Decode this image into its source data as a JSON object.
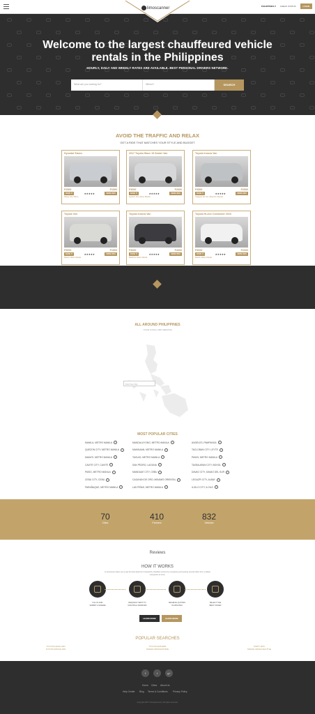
{
  "header": {
    "logo_text": "limoscanner",
    "country": "PHILIPPINES",
    "check_status": "CHECK STATUS",
    "login": "LOGIN"
  },
  "hero": {
    "title_line1": "Welcome to the largest chauffeured vehicle",
    "title_line2": "rentals in the Philippines",
    "subtitle": "HOURLY, DAILY AND WEEKLY RATES ARE AVAILABLE. BEST PERSONAL DRIVERS NETWORK.",
    "what_placeholder": "What are you looking for?",
    "where_placeholder": "Where?",
    "search_button": "SEARCH"
  },
  "vehicles": {
    "title": "AVOID THE TRAFFIC AND RELAX",
    "subtitle": "GET A RIDE THAT MATCHES YOUR STYLE AND BUDGET",
    "cards": [
      {
        "name": "Hyundai Starex",
        "p1": "P2500",
        "p2": "P1500",
        "tag": "BOOK IT",
        "more": "MORE INFO",
        "stars": "★★★★★",
        "loc": "Pasay City, Metro",
        "car_color": "#c9ccd0"
      },
      {
        "name": "2017 Toyota Hiace 15 Seater Van",
        "p1": "P3000",
        "p2": "P2000",
        "tag": "BOOK IT",
        "more": "MORE INFO",
        "stars": "★★★★★",
        "loc": "Quezon City, Metro Manila",
        "car_color": "#d6d7d8"
      },
      {
        "name": "Toyota Innova Van",
        "p1": "P3500",
        "p2": "P2500",
        "tag": "BOOK IT",
        "more": "MORE INFO",
        "stars": "★★★★★",
        "loc": "Cagayan de Oro, Misamis Oriental",
        "car_color": "#bfc2c5"
      },
      {
        "name": "Toyota Van",
        "p1": "P3000",
        "p2": "P1500",
        "tag": "BOOK IT",
        "more": "MORE INFO",
        "stars": "★★★★★",
        "loc": "Manila, Metro Manila",
        "car_color": "#d9d9d6"
      },
      {
        "name": "Toyota Innova Van",
        "p1": "P3000",
        "p2": "P4000",
        "tag": "BOOK IT",
        "more": "MORE INFO",
        "stars": "★★★★★",
        "loc": "Marikina, Metro Manila",
        "car_color": "#3b3b40"
      },
      {
        "name": "Toyota Hi-Ace Commuter 2016",
        "p1": "P3000",
        "p2": "P2000",
        "tag": "BOOK IT",
        "more": "MORE INFO",
        "stars": "★★★★★",
        "loc": "Manila, Metro Manila",
        "car_color": "#f1f1f1"
      }
    ]
  },
  "map": {
    "title": "ALL AROUND PHILIPPINES",
    "subtitle": "YOUR LOCAL LIMO SERVICE",
    "input_placeholder": "Find Your City"
  },
  "cities": {
    "title": "MOST POPULAR CITIES",
    "items": [
      "MANILA, METRO MANILA",
      "MANDALUYONG, METRO MANILA",
      "ANGELES, PAMPANGA",
      "QUEZON CITY, METRO MANILA",
      "MAKINAAN, METRO MANILA",
      "TACLOBAN CITY, LEYTE",
      "MAKATI, METRO MANILA",
      "TAGUIG, METRO MANILA",
      "PASAY, METRO MANILA",
      "CAVITE CITY, CAVITE",
      "SAN PEDRO, LAGUNA",
      "TAGBILARAN CITY, BOHOL",
      "PASIG, METRO MANILA",
      "MANDAUE CITY, CEBU",
      "DAVAO CITY, DAVAO DEL SUR",
      "CEBU CITY, CEBU",
      "CAGAYAN DE ORO, MISAMIS ORIENTAL",
      "LEGAZPI CITY, ALBAY",
      "PARAÑAQUE, METRO MANILA",
      "LAS PIÑAS, METRO MANILA",
      "ILOILO CITY, ILOILO"
    ]
  },
  "stats": [
    {
      "number": "70",
      "label": "Cities"
    },
    {
      "number": "410",
      "label": "Partners"
    },
    {
      "number": "832",
      "label": "Vehicles"
    }
  ],
  "reviews_title": "Reviews",
  "how": {
    "title": "HOW IT WORKS",
    "desc_line1": "Limoscanner helps you to get the best deal from trustworthy chauffeur service by comparing and quoting",
    "desc_line2": "several offers from multiple companies at once.",
    "steps": [
      {
        "l1": "FILL IN AND",
        "l2": "SUBMIT A WHERE"
      },
      {
        "l1": "REQUEST SENT TO",
        "l2": "MULTIPLE VENDORS"
      },
      {
        "l1": "RECEIVE QUOTES",
        "l2": "IN MINUTES"
      },
      {
        "l1": "SELECT THE",
        "l2": "BEST OFFER"
      }
    ],
    "btn_dark": "LEARN MORE",
    "btn_gold": "LEARN MORE"
  },
  "popular": {
    "title": "POPULAR SEARCHES",
    "left_l1": "TOYOTA HIACE VAN",
    "left_l2": "TOYOTA INNOVA VAN",
    "mid_l1": "TOYOTA ALPHARD",
    "mid_l2": "NISSAN URVAN ESTATE",
    "right_l1": "PARTY BUS",
    "right_l2": "NISSAN URVAN SHUTTLE"
  },
  "footer": {
    "social": [
      "f",
      "t",
      "g+"
    ],
    "row1": [
      "Home",
      "Cities",
      "About Us"
    ],
    "row2": [
      "Help Center",
      "Blog",
      "Terms & Conditions",
      "Privacy Policy"
    ],
    "copyright": "Copyright 2017 limoscanner.ph | All rights reserved."
  },
  "colors": {
    "accent": "#b5965f",
    "dark": "#2e2e2e"
  }
}
